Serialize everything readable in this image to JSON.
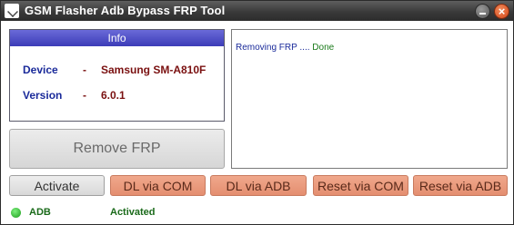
{
  "window": {
    "title": "GSM Flasher Adb Bypass FRP Tool",
    "close_glyph": "×"
  },
  "info": {
    "header": "Info",
    "device_label": "Device",
    "device_value": "Samsung SM-A810F",
    "version_label": "Version",
    "version_value": "6.0.1",
    "separator": "-"
  },
  "log": {
    "message": "Removing FRP .... ",
    "status": "Done"
  },
  "buttons": {
    "remove_frp": "Remove FRP",
    "activate": "Activate",
    "dl_via_com": "DL via COM",
    "dl_via_adb": "DL via ADB",
    "reset_via_com": "Reset via COM",
    "reset_via_adb": "Reset via ADB"
  },
  "status": {
    "connection": "ADB",
    "activation": "Activated"
  },
  "colors": {
    "title_bar": "#3a3a3a",
    "info_header": "#4a4ac8",
    "label_blue": "#1a2a9a",
    "value_dark_red": "#7a1010",
    "status_green": "#1a7a1a",
    "orange_button": "#e89a7c"
  },
  "icons": {
    "app": "app-icon",
    "minimize": "minimize-icon",
    "close": "close-icon",
    "status": "status-led-icon"
  }
}
